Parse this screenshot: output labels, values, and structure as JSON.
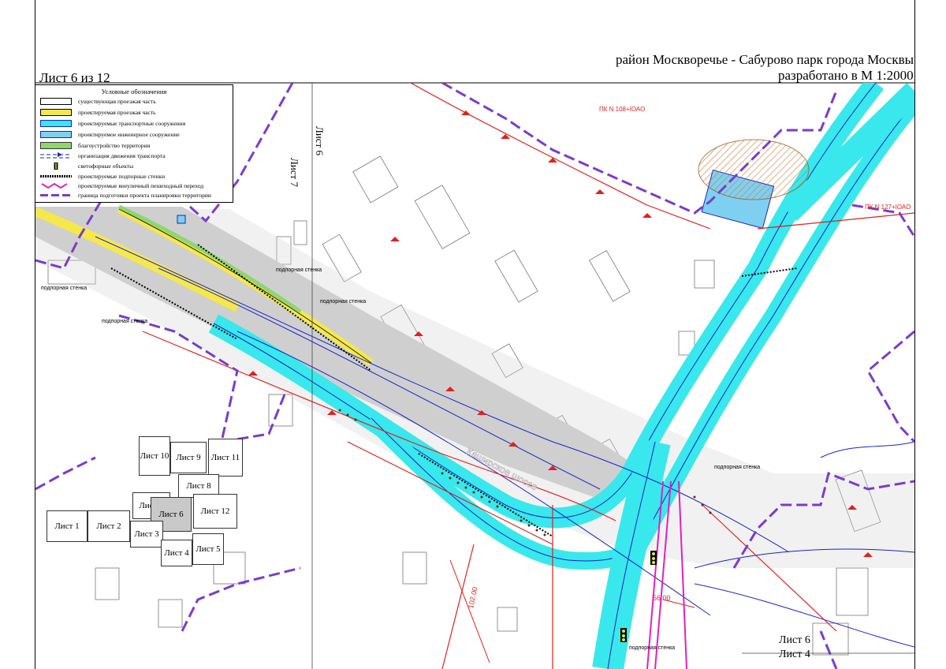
{
  "header": {
    "sheet_number": "Лист 6 из 12",
    "district": "район Москворечье - Сабурово парк города Москвы",
    "scale": "разработано в М 1:2000"
  },
  "legend": {
    "title": "Условные обозначения",
    "items": [
      {
        "label": "существующая проезжая часть",
        "icon": "existing-road-swatch",
        "color": "#ffffff"
      },
      {
        "label": "проектируемая проезжая часть",
        "icon": "planned-road-swatch",
        "color": "#f5e84a"
      },
      {
        "label": "проектируемые транспортные сооружения",
        "icon": "transport-structure-swatch",
        "color": "#38e8ec"
      },
      {
        "label": "проектируемое инженерное сооружение",
        "icon": "engineering-structure-swatch",
        "color": "#7fd0f0"
      },
      {
        "label": "благоустройство территории",
        "icon": "landscaping-swatch",
        "color": "#8fd66e"
      },
      {
        "label": "организация движения транспорта",
        "icon": "traffic-arrow-icon",
        "color": "#1a22c8"
      },
      {
        "label": "светофорные объекты",
        "icon": "traffic-light-icon",
        "color": "#000000"
      },
      {
        "label": "проектируемые подпорные стенки",
        "icon": "retaining-wall-swatch",
        "color": "#000000"
      },
      {
        "label": "проектируемые внеуличный пешеходный переход",
        "icon": "pedestrian-crossing-icon",
        "color": "#e020c0"
      },
      {
        "label": "граница подготовки проекта планировки территории",
        "icon": "boundary-line-swatch",
        "color": "#7a3ccc"
      }
    ]
  },
  "labels": {
    "sheet7": "Лист 7",
    "sheet6_top": "Лист 6",
    "retaining_wall_1": "подпорная стенка",
    "retaining_wall_2": "подпорная стенка",
    "retaining_wall_3": "подпорная стенка",
    "retaining_wall_4": "подпорная стенка",
    "retaining_wall_5": "подпорная стенка",
    "retaining_wall_6": "подпорная стенка",
    "pk108": "ПК N 108+IОАО",
    "pk127": "ПК N 127+IОАО",
    "street_kashirskoe": "Каширское шоссе",
    "sheet6_bottom": "Лист 6",
    "sheet4_bottom": "Лист 4",
    "dim_102": "102.00",
    "dim_56": "56.00"
  },
  "sheet_index": [
    {
      "label": "Лист 10",
      "current": false
    },
    {
      "label": "Лист 9",
      "current": false
    },
    {
      "label": "Лист 11",
      "current": false
    },
    {
      "label": "Лист 8",
      "current": false
    },
    {
      "label": "Лист 7",
      "current": false
    },
    {
      "label": "Лист 6",
      "current": true
    },
    {
      "label": "Лист 12",
      "current": false
    },
    {
      "label": "Лист 1",
      "current": false
    },
    {
      "label": "Лист 2",
      "current": false
    },
    {
      "label": "Лист 3",
      "current": false
    },
    {
      "label": "Лист 4",
      "current": false
    },
    {
      "label": "Лист 5",
      "current": false
    }
  ],
  "colors": {
    "boundary": "#7a3ccc",
    "transport": "#38e8ec",
    "road_yellow": "#f5e84a",
    "red_line": "#e02020",
    "traffic_blue": "#1a22c8",
    "green": "#8fd66e"
  }
}
